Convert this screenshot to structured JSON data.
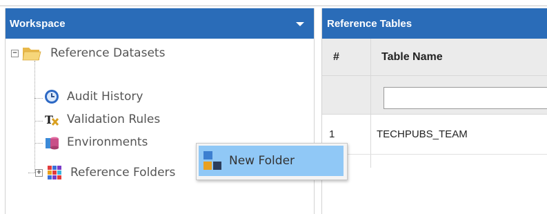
{
  "workspace": {
    "title": "Workspace",
    "tree": {
      "root_label": "Reference Datasets",
      "children": [
        {
          "label": "Audit History",
          "icon": "clock-globe-icon"
        },
        {
          "label": "Validation Rules",
          "icon": "tx-rules-icon"
        },
        {
          "label": "Environments",
          "icon": "database-stack-icon"
        },
        {
          "label": "Reference Folders",
          "icon": "colored-grid-icon"
        }
      ]
    }
  },
  "reference_tables": {
    "title": "Reference Tables",
    "columns": [
      "#",
      "Table Name"
    ],
    "rows": [
      {
        "num": "1",
        "name": "TECHPUBS_TEAM"
      }
    ]
  },
  "context_menu": {
    "items": [
      {
        "label": "New Folder",
        "icon": "new-folder-icon"
      }
    ]
  },
  "colors": {
    "header_blue": "#2a6cb8",
    "menu_highlight": "#90c8f6",
    "grid_header_bg": "#ebebeb"
  }
}
